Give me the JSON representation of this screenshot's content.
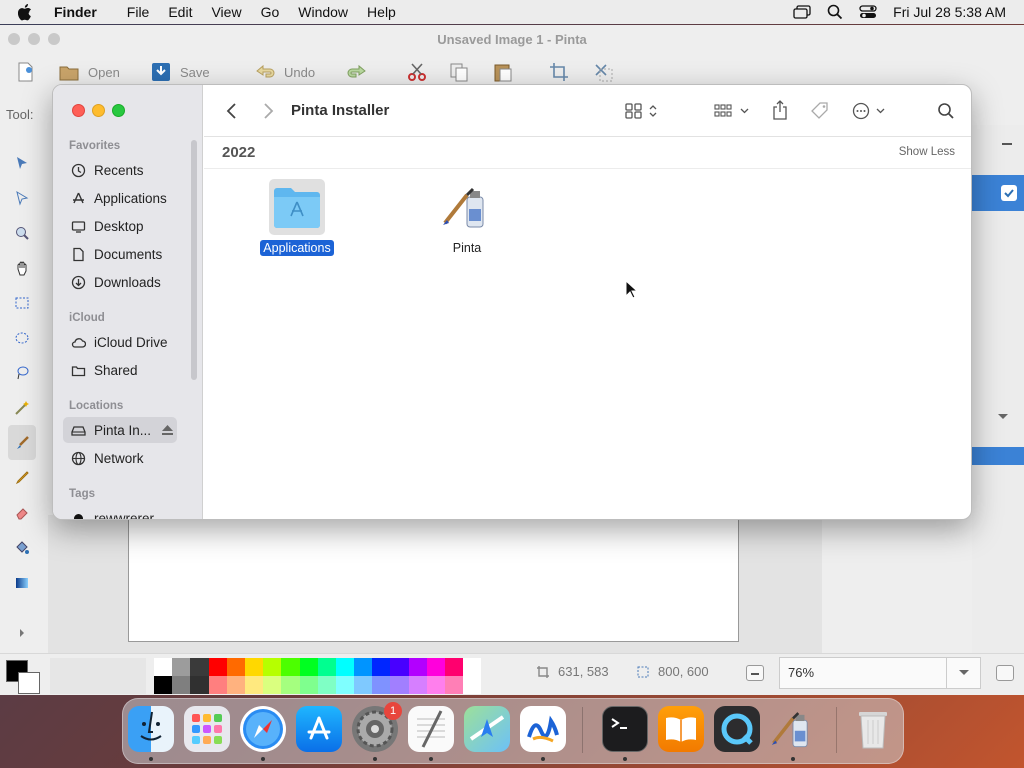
{
  "menubar": {
    "app_name": "Finder",
    "items": [
      "File",
      "Edit",
      "View",
      "Go",
      "Window",
      "Help"
    ],
    "datetime": "Fri Jul 28  5:38 AM"
  },
  "pinta": {
    "title": "Unsaved Image 1 - Pinta",
    "toolbar": {
      "open": "Open",
      "save": "Save",
      "undo": "Undo"
    },
    "tool_label": "Tool:",
    "status": {
      "cursor_pos": "631, 583",
      "selection_size": "800, 600",
      "zoom": "76%"
    },
    "palette_top": [
      "#ffffff",
      "#9c9c9c",
      "#3a3a3a",
      "#ff0000",
      "#ff6a00",
      "#ffd800",
      "#b6ff00",
      "#4cff00",
      "#00ff21",
      "#00ff90",
      "#00ffff",
      "#0094ff",
      "#0026ff",
      "#4800ff",
      "#b200ff",
      "#ff00dc",
      "#ff006e",
      "#ffffff"
    ],
    "palette_bottom": [
      "#000000",
      "#7f7f7f",
      "#303030",
      "#ff7f7f",
      "#ffb27f",
      "#ffe97f",
      "#daff7f",
      "#a5ff7f",
      "#7fff8e",
      "#7fffc5",
      "#7fffff",
      "#7fc9ff",
      "#7f92ff",
      "#a17fff",
      "#d67fff",
      "#ff7fed",
      "#ff7fb6",
      "#ffffff"
    ]
  },
  "finder": {
    "title": "Pinta Installer",
    "group": "2022",
    "show_less": "Show Less",
    "sidebar": {
      "favorites_label": "Favorites",
      "favorites": [
        "Recents",
        "Applications",
        "Desktop",
        "Documents",
        "Downloads"
      ],
      "icloud_label": "iCloud",
      "icloud": [
        "iCloud Drive",
        "Shared"
      ],
      "locations_label": "Locations",
      "locations": [
        "Pinta In...",
        "Network"
      ],
      "tags_label": "Tags",
      "tags": [
        "rewwrerer"
      ]
    },
    "items": [
      {
        "name": "Applications",
        "selected": true
      },
      {
        "name": "Pinta",
        "selected": false
      }
    ]
  },
  "dock": {
    "apps": [
      "Finder",
      "Launchpad",
      "Safari",
      "App Store",
      "System Settings",
      "TextEdit",
      "Maps",
      "Freeform",
      "Terminal",
      "Books",
      "QuickTime Player",
      "Pinta",
      "Trash"
    ],
    "settings_badge": "1"
  }
}
